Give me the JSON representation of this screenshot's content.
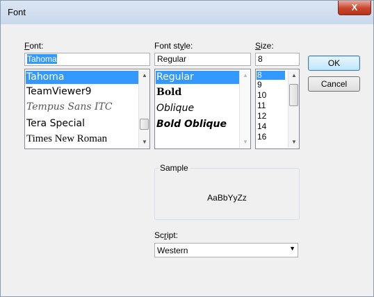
{
  "dialog": {
    "title": "Font",
    "close_symbol": "X"
  },
  "font": {
    "label_key": "F",
    "label_rest": "ont:",
    "value": "Tahoma",
    "items": [
      "Tahoma",
      "TeamViewer9",
      "Tempus Sans ITC",
      "Tera Special",
      "Times New Roman"
    ],
    "selected_index": 0
  },
  "style": {
    "label_pre": "Font st",
    "label_key": "y",
    "label_rest": "le:",
    "value": "Regular",
    "items": [
      "Regular",
      "Bold",
      "Oblique",
      "Bold Oblique"
    ],
    "selected_index": 0
  },
  "size": {
    "label_key": "S",
    "label_rest": "ize:",
    "value": "8",
    "items": [
      "8",
      "9",
      "10",
      "11",
      "12",
      "14",
      "16"
    ],
    "selected_index": 0
  },
  "buttons": {
    "ok": "OK",
    "cancel": "Cancel"
  },
  "sample": {
    "label": "Sample",
    "text": "AaBbYyZz"
  },
  "script": {
    "label_pre": "Sc",
    "label_key": "r",
    "label_rest": "ipt:",
    "value": "Western"
  }
}
